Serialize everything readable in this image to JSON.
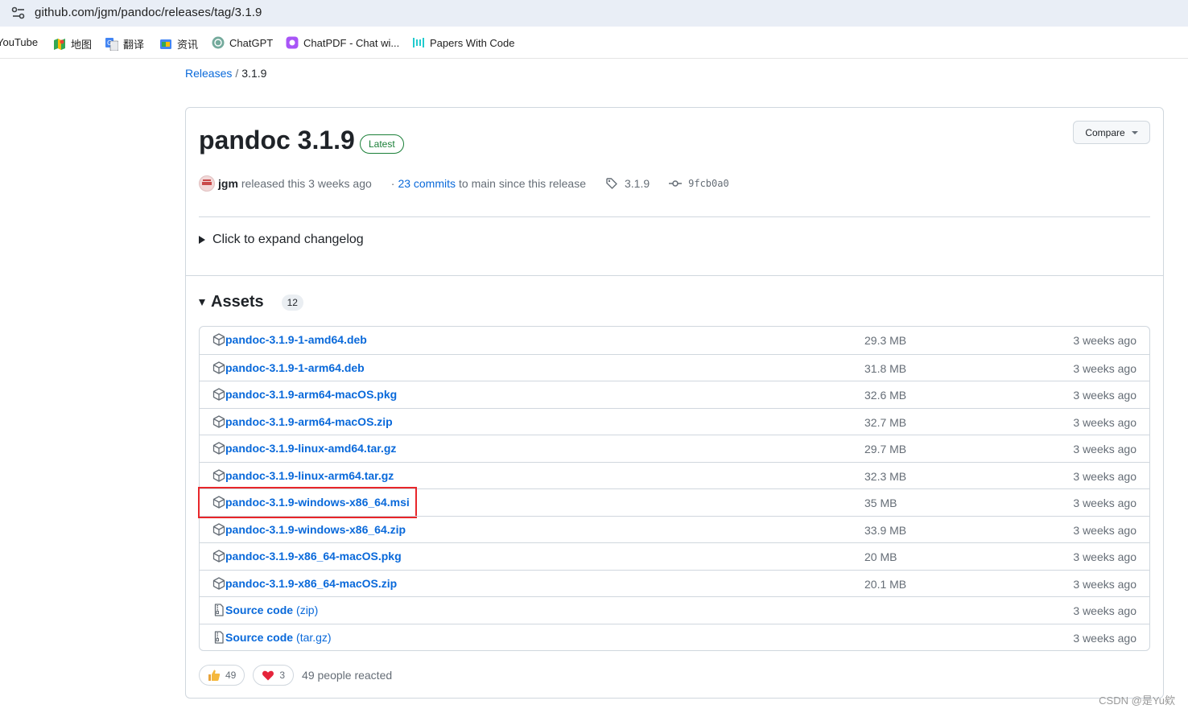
{
  "browser": {
    "url": "github.com/jgm/pandoc/releases/tag/3.1.9"
  },
  "bookmarks": [
    {
      "label": "YouTube",
      "icon": "youtube-icon"
    },
    {
      "label": "地图",
      "icon": "maps-icon"
    },
    {
      "label": "翻译",
      "icon": "translate-icon"
    },
    {
      "label": "资讯",
      "icon": "news-icon"
    },
    {
      "label": "ChatGPT",
      "icon": "chatgpt-icon"
    },
    {
      "label": "ChatPDF - Chat wi...",
      "icon": "chatpdf-icon"
    },
    {
      "label": "Papers With Code",
      "icon": "paperswithcode-icon"
    }
  ],
  "breadcrumb": {
    "root": "Releases",
    "separator": "/",
    "current": "3.1.9"
  },
  "release": {
    "title": "pandoc 3.1.9",
    "badge": "Latest",
    "compare_label": "Compare",
    "author": "jgm",
    "released_text": "released this 3 weeks ago",
    "commits_prefix": "·",
    "commits_link": "23 commits",
    "commits_suffix": "to main since this release",
    "tag": "3.1.9",
    "commit_sha": "9fcb0a0",
    "changelog_label": "Click to expand changelog"
  },
  "assets": {
    "title": "Assets",
    "count": "12",
    "items": [
      {
        "name": "pandoc-3.1.9-1-amd64.deb",
        "size": "29.3 MB",
        "date": "3 weeks ago"
      },
      {
        "name": "pandoc-3.1.9-1-arm64.deb",
        "size": "31.8 MB",
        "date": "3 weeks ago"
      },
      {
        "name": "pandoc-3.1.9-arm64-macOS.pkg",
        "size": "32.6 MB",
        "date": "3 weeks ago"
      },
      {
        "name": "pandoc-3.1.9-arm64-macOS.zip",
        "size": "32.7 MB",
        "date": "3 weeks ago"
      },
      {
        "name": "pandoc-3.1.9-linux-amd64.tar.gz",
        "size": "29.7 MB",
        "date": "3 weeks ago"
      },
      {
        "name": "pandoc-3.1.9-linux-arm64.tar.gz",
        "size": "32.3 MB",
        "date": "3 weeks ago"
      },
      {
        "name": "pandoc-3.1.9-windows-x86_64.msi",
        "size": "35 MB",
        "date": "3 weeks ago"
      },
      {
        "name": "pandoc-3.1.9-windows-x86_64.zip",
        "size": "33.9 MB",
        "date": "3 weeks ago"
      },
      {
        "name": "pandoc-3.1.9-x86_64-macOS.pkg",
        "size": "20 MB",
        "date": "3 weeks ago"
      },
      {
        "name": "pandoc-3.1.9-x86_64-macOS.zip",
        "size": "20.1 MB",
        "date": "3 weeks ago"
      },
      {
        "name": "Source code",
        "sub": "(zip)",
        "size": "",
        "date": "3 weeks ago"
      },
      {
        "name": "Source code",
        "sub": "(tar.gz)",
        "size": "",
        "date": "3 weeks ago"
      }
    ]
  },
  "reactions": {
    "thumbs_up_count": "49",
    "heart_count": "3",
    "people_text": "49 people reacted"
  },
  "watermark": "CSDN @是Yu欸",
  "colors": {
    "link": "#0969da",
    "latest_green": "#1a7f37",
    "highlight_red": "#e8262a",
    "border": "#d0d7de"
  }
}
